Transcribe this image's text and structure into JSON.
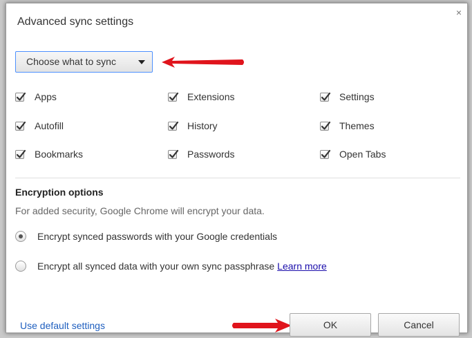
{
  "dialog": {
    "title": "Advanced sync settings",
    "close_label": "×"
  },
  "sync_select": {
    "selected": "Choose what to sync"
  },
  "sync_items": [
    {
      "label": "Apps",
      "checked": true
    },
    {
      "label": "Extensions",
      "checked": true
    },
    {
      "label": "Settings",
      "checked": true
    },
    {
      "label": "Autofill",
      "checked": true
    },
    {
      "label": "History",
      "checked": true
    },
    {
      "label": "Themes",
      "checked": true
    },
    {
      "label": "Bookmarks",
      "checked": true
    },
    {
      "label": "Passwords",
      "checked": true
    },
    {
      "label": "Open Tabs",
      "checked": true
    }
  ],
  "encryption": {
    "title": "Encryption options",
    "description": "For added security, Google Chrome will encrypt your data.",
    "option1": "Encrypt synced passwords with your Google credentials",
    "option1_selected": true,
    "option2": "Encrypt all synced data with your own sync passphrase",
    "option2_selected": false,
    "learn_more": "Learn more"
  },
  "footer": {
    "default_link": "Use default settings",
    "ok_label": "OK",
    "cancel_label": "Cancel"
  },
  "colors": {
    "annotation_arrow": "#e0141c",
    "link": "#1a0dab",
    "focus_border": "#4d90fe"
  }
}
